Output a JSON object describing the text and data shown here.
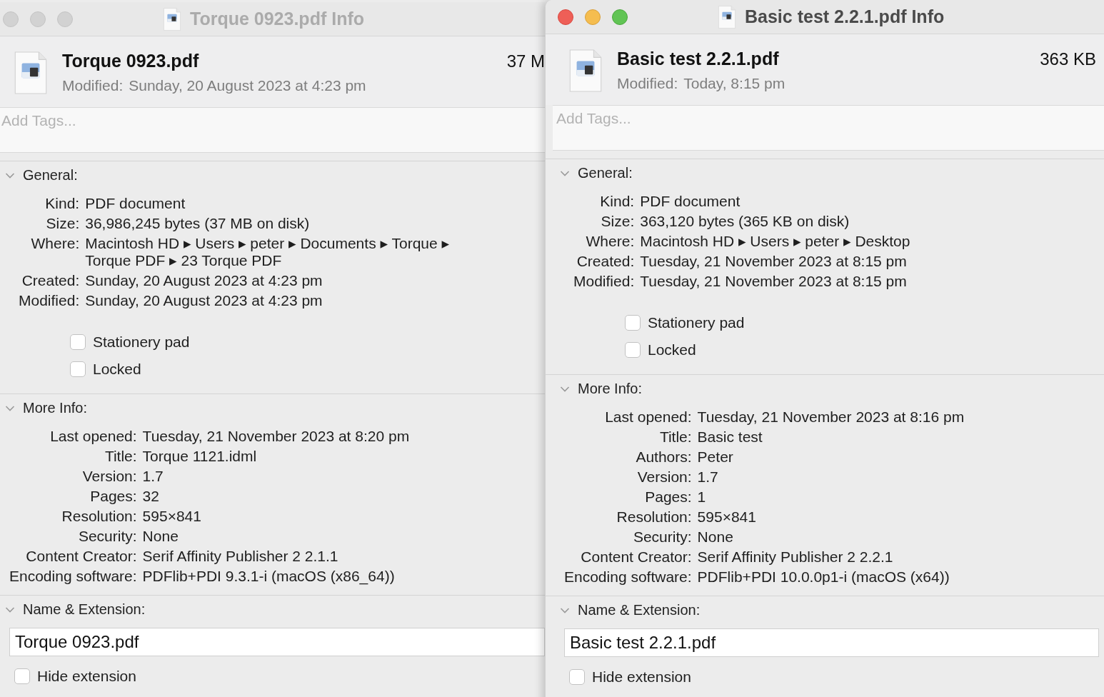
{
  "windows": [
    {
      "title": "Torque 0923.pdf Info",
      "active": false,
      "file": {
        "name": "Torque 0923.pdf",
        "size": "37 M",
        "modified_label": "Modified:",
        "modified_value": "Sunday, 20 August 2023 at 4:23 pm"
      },
      "tags": {
        "placeholder": "Add Tags..."
      },
      "sections": [
        {
          "kind": "info",
          "title": "General:",
          "expanded": true,
          "rows": [
            {
              "label": "Kind:",
              "value": "PDF document"
            },
            {
              "label": "Size:",
              "value": "36,986,245 bytes (37 MB on disk)"
            },
            {
              "label": "Where:",
              "value": "Macintosh HD ▸ Users ▸ peter ▸ Documents ▸ Torque ▸ Torque PDF ▸ 23 Torque PDF"
            },
            {
              "label": "Created:",
              "value": "Sunday, 20 August 2023 at 4:23 pm"
            },
            {
              "label": "Modified:",
              "value": "Sunday, 20 August 2023 at 4:23 pm"
            }
          ],
          "checkboxes": [
            {
              "label": "Stationery pad",
              "checked": false
            },
            {
              "label": "Locked",
              "checked": false
            }
          ]
        },
        {
          "kind": "info",
          "title": "More Info:",
          "expanded": true,
          "rows": [
            {
              "label": "Last opened:",
              "value": "Tuesday, 21 November 2023 at 8:20 pm"
            },
            {
              "label": "Title:",
              "value": "Torque 1121.idml"
            },
            {
              "label": "Version:",
              "value": "1.7"
            },
            {
              "label": "Pages:",
              "value": "32"
            },
            {
              "label": "Resolution:",
              "value": "595×841"
            },
            {
              "label": "Security:",
              "value": "None"
            },
            {
              "label": "Content Creator:",
              "value": "Serif Affinity Publisher 2 2.1.1"
            },
            {
              "label": "Encoding software:",
              "value": "PDFlib+PDI 9.3.1-i (macOS (x86_64))"
            }
          ]
        },
        {
          "kind": "name",
          "title": "Name & Extension:",
          "expanded": true,
          "value": "Torque 0923.pdf",
          "checkboxes": [
            {
              "label": "Hide extension",
              "checked": false
            }
          ]
        }
      ]
    },
    {
      "title": "Basic test 2.2.1.pdf Info",
      "active": true,
      "file": {
        "name": "Basic test 2.2.1.pdf",
        "size": "363 KB",
        "modified_label": "Modified:",
        "modified_value": "Today, 8:15 pm"
      },
      "tags": {
        "placeholder": "Add Tags..."
      },
      "sections": [
        {
          "kind": "info",
          "title": "General:",
          "expanded": true,
          "rows": [
            {
              "label": "Kind:",
              "value": "PDF document"
            },
            {
              "label": "Size:",
              "value": "363,120 bytes (365 KB on disk)"
            },
            {
              "label": "Where:",
              "value": "Macintosh HD ▸ Users ▸ peter ▸ Desktop"
            },
            {
              "label": "Created:",
              "value": "Tuesday, 21 November 2023 at 8:15 pm"
            },
            {
              "label": "Modified:",
              "value": "Tuesday, 21 November 2023 at 8:15 pm"
            }
          ],
          "checkboxes": [
            {
              "label": "Stationery pad",
              "checked": false
            },
            {
              "label": "Locked",
              "checked": false
            }
          ]
        },
        {
          "kind": "info",
          "title": "More Info:",
          "expanded": true,
          "rows": [
            {
              "label": "Last opened:",
              "value": "Tuesday, 21 November 2023 at 8:16 pm"
            },
            {
              "label": "Title:",
              "value": "Basic test"
            },
            {
              "label": "Authors:",
              "value": "Peter"
            },
            {
              "label": "Version:",
              "value": "1.7"
            },
            {
              "label": "Pages:",
              "value": "1"
            },
            {
              "label": "Resolution:",
              "value": "595×841"
            },
            {
              "label": "Security:",
              "value": "None"
            },
            {
              "label": "Content Creator:",
              "value": "Serif Affinity Publisher 2 2.2.1"
            },
            {
              "label": "Encoding software:",
              "value": "PDFlib+PDI 10.0.0p1-i (macOS (x64))"
            }
          ]
        },
        {
          "kind": "name",
          "title": "Name & Extension:",
          "expanded": true,
          "value": "Basic test 2.2.1.pdf",
          "checkboxes": [
            {
              "label": "Hide extension",
              "checked": false
            }
          ]
        }
      ]
    }
  ]
}
